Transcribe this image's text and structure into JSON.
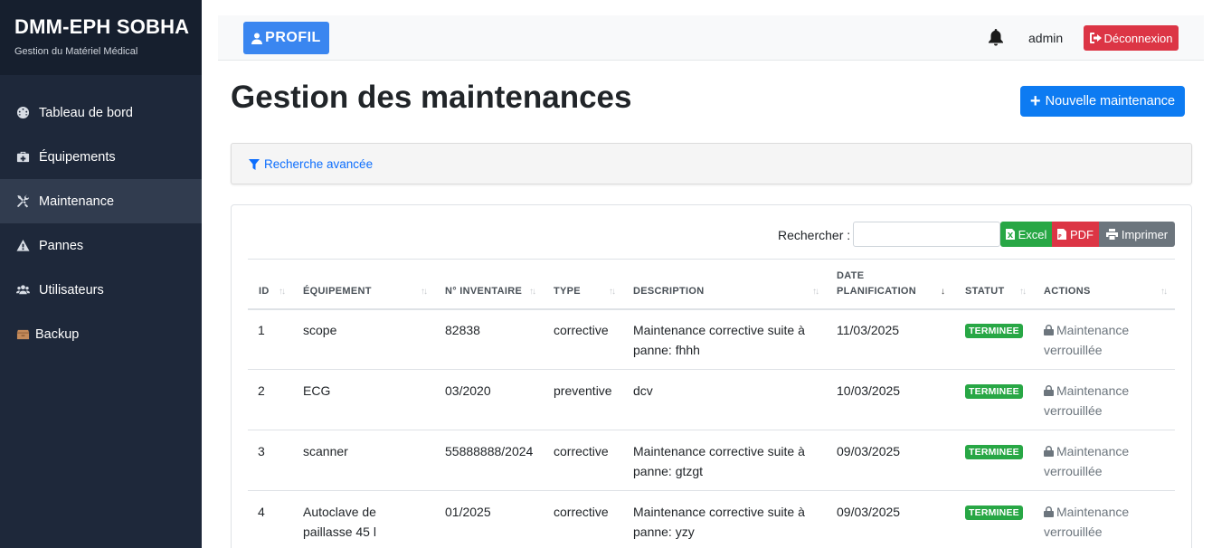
{
  "brand": {
    "title": "DMM-EPH SOBHA",
    "subtitle": "Gestion du Matériel Médical"
  },
  "sidebar": {
    "items": [
      {
        "label": "Tableau de bord",
        "icon": "dashboard-icon",
        "active": false
      },
      {
        "label": "Équipements",
        "icon": "medkit-icon",
        "active": false
      },
      {
        "label": "Maintenance",
        "icon": "tools-icon",
        "active": true
      },
      {
        "label": "Pannes",
        "icon": "warning-icon",
        "active": false
      },
      {
        "label": "Utilisateurs",
        "icon": "users-icon",
        "active": false
      },
      {
        "label": "Backup",
        "icon": "box-icon",
        "active": false
      }
    ]
  },
  "topbar": {
    "profil_label": "PROFIL",
    "user": "admin",
    "logout_label": "Déconnexion"
  },
  "page": {
    "title": "Gestion des maintenances",
    "new_button": "Nouvelle maintenance",
    "advanced_search": "Recherche avancée"
  },
  "toolbar": {
    "search_label": "Rechercher :",
    "search_value": "",
    "excel": "Excel",
    "pdf": "PDF",
    "print": "Imprimer"
  },
  "table": {
    "columns": {
      "id": "ID",
      "equipement": "ÉQUIPEMENT",
      "inventaire": "N° INVENTAIRE",
      "type": "TYPE",
      "description": "DESCRIPTION",
      "date_line1": "DATE",
      "date_line2": "PLANIFICATION",
      "statut": "STATUT",
      "actions": "ACTIONS"
    },
    "rows": [
      {
        "id": "1",
        "equip_1": "scope",
        "equip_2": "",
        "inventaire": "82838",
        "type": "corrective",
        "desc_1": "Maintenance corrective suite à",
        "desc_2": "panne: fhhh",
        "date": "11/03/2025",
        "statut": "TERMINEE",
        "action_1": "Maintenance",
        "action_2": "verrouillée"
      },
      {
        "id": "2",
        "equip_1": "ECG",
        "equip_2": "",
        "inventaire": "03/2020",
        "type": "preventive",
        "desc_1": "dcv",
        "desc_2": "",
        "date": "10/03/2025",
        "statut": "TERMINEE",
        "action_1": "Maintenance",
        "action_2": "verrouillée"
      },
      {
        "id": "3",
        "equip_1": "scanner",
        "equip_2": "",
        "inventaire": "55888888/2024",
        "type": "corrective",
        "desc_1": "Maintenance corrective suite à",
        "desc_2": "panne: gtzgt",
        "date": "09/03/2025",
        "statut": "TERMINEE",
        "action_1": "Maintenance",
        "action_2": "verrouillée"
      },
      {
        "id": "4",
        "equip_1": "Autoclave de",
        "equip_2": "paillasse 45 l",
        "inventaire": "01/2025",
        "type": "corrective",
        "desc_1": "Maintenance corrective suite à",
        "desc_2": "panne: yzy",
        "date": "09/03/2025",
        "statut": "TERMINEE",
        "action_1": "Maintenance",
        "action_2": "verrouillée"
      }
    ]
  },
  "colors": {
    "sidebar": "#1e283a",
    "primary": "#0d7bf2",
    "danger": "#dc3545",
    "success": "#28a745",
    "secondary": "#6c757d"
  }
}
